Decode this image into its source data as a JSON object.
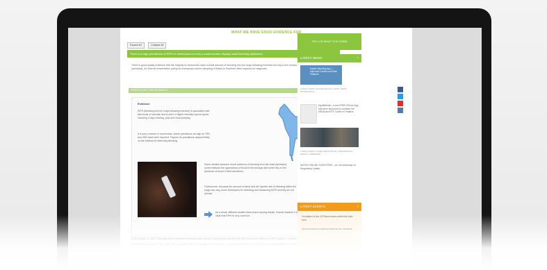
{
  "page": {
    "title": "WHAT WE HAVE GOOD EVIDENCE FOR",
    "expand_all": "Expand All",
    "collapse_all": "Collapse All",
    "question": "There is a high prevalence of EIPH in racehorses but only a small number display nasal bleeding (epistaxis)",
    "intro": "There is good quality evidence that the majority of racehorses have a small amount of bleeding into the lungs following exercise but only a few horses display nasal bleeding (epistaxis). An internal examination (using an endoscope and/or sampling of fluids) is therefore often required for diagnosis.",
    "sub_heading": "WHERE DOES THIS EVIDENCE ...",
    "evidence": {
      "heading": "Evidence",
      "p1": "EIPH (bleeding into the lungs following exercise) is associated with fast bouts of exercise and is seen in higher intensity equine sports including 3-day eventing, polo and show jumping.",
      "p2": "It is very common in racehorses, where prevalence as high as 75% and 95% have been reported. Figures for prevalence depend firstly on the method for detecting bleeding.",
      "p3": "Some studies measure visual evidence of bleeding from the nose (epistaxis); some measure the appearance of blood in the airways and some rely on the presence of blood in fluid secretions.",
      "p4": "Furthermore, because the amount of blood and the specific site of bleeding within the lungs can vary, some techniques for detecting and measuring EIPH severity are not precise.",
      "p5": "As a result, different studies have found varying results. Overall however it is clear that EIPH is very common."
    },
    "bullets": [
      "A 2015 study of 1,000 Thoroughbreds evaluated immediately after racing in South Africa reported that 66% had visual evidence of EIPH grade 1 or above.",
      "A 2002 a similar study of 744 horses, Thoroughbreds with a mean age at enrolment of 4.1 years reported that 55% of horses had visual evidence of EIPH after racing."
    ]
  },
  "sidebar": {
    "cta": "TELL US WHAT YOU THINK",
    "news_heading": "LATEST NEWS",
    "news_thumb_text": "Equine Bleeding App — Improved Content and New Features",
    "news_meta_1": "LATEST NEWS, EQUINE HEALTH, APPS, NEWS, INFORMATION",
    "news_item_1": "EquiBleeder: a new FREE iPhone App has been launched to combine the HBLB and NTF Codes of Practice",
    "news_meta_2": "LATEST NEWS, OTHER RESOURCES, RESPIRATORY HEALTH, WEBINARS",
    "news_item_2": "WATCH ONLINE SOON FREE - our vet workshop on Respiratory Health",
    "events_heading": "LATEST EVENTS",
    "event_1": "Circulation of the 15 Racecourses within the pilot area",
    "event_2": "Annual network workshop/ seminar for members"
  },
  "colors": {
    "accent_green": "#8cc63f",
    "events_orange": "#f29b1a",
    "facebook": "#3b5998",
    "twitter": "#1da1f2",
    "youtube": "#e52d27",
    "instagram": "#517fa4"
  },
  "icons": [
    "facebook-icon",
    "twitter-icon",
    "youtube-icon",
    "instagram-icon",
    "arrow-right-icon",
    "chevron-right-icon"
  ]
}
